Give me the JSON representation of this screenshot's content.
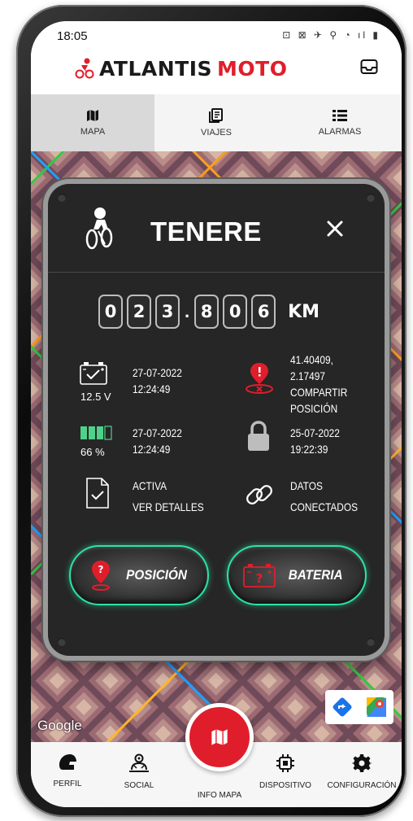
{
  "status_bar": {
    "time": "18:05",
    "icons": "⊡ ⊠ ✈ ⚲ ◔ ıl ▮"
  },
  "header": {
    "brand_left": "ATLANTIS",
    "brand_right": "MOTO"
  },
  "tabs": [
    {
      "label": "MAPA",
      "active": true
    },
    {
      "label": "VIAJES",
      "active": false
    },
    {
      "label": "ALARMAS",
      "active": false
    }
  ],
  "card": {
    "title": "TENERE",
    "odometer": {
      "digits": [
        "0",
        "2",
        "3",
        "8",
        "0",
        "6"
      ],
      "unit": "KM"
    },
    "battery_voltage": {
      "value": "12.5 V",
      "date": "27-07-2022",
      "time": "12:24:49"
    },
    "location": {
      "coords": "41.40409, 2.17497",
      "line2": "COMPARTIR",
      "line3": "POSICIÓN"
    },
    "battery_level": {
      "value": "66 %",
      "date": "27-07-2022",
      "time": "12:24:49"
    },
    "lock": {
      "date": "25-07-2022",
      "time": "19:22:39"
    },
    "status": {
      "line1": "ACTIVA",
      "line2": "VER DETALLES"
    },
    "connection": {
      "line1": "DATOS",
      "line2": "CONECTADOS"
    },
    "buttons": {
      "position": "POSICIÓN",
      "battery": "BATERIA"
    }
  },
  "map": {
    "attribution": "Google"
  },
  "bottom_nav": {
    "profile": "PERFIL",
    "social": "SOCIAL",
    "map_info": "INFO MAPA",
    "device": "DISPOSITIVO",
    "settings": "CONFIGURACIÓN"
  },
  "colors": {
    "brand_red": "#e01e2b",
    "accent_green": "#2de3a3",
    "card_bg": "#262626"
  }
}
